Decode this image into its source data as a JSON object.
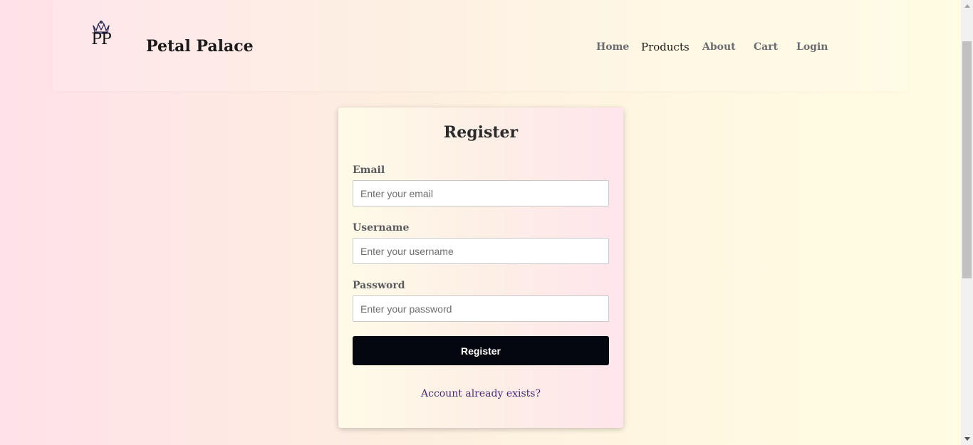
{
  "header": {
    "logo_monogram": "PP",
    "brand": "Petal Palace",
    "nav": [
      {
        "label": "Home"
      },
      {
        "label": "Products"
      },
      {
        "label": "About"
      },
      {
        "label": "Cart"
      },
      {
        "label": "Login"
      }
    ],
    "active_nav": "Products"
  },
  "form": {
    "title": "Register",
    "fields": [
      {
        "label": "Email",
        "placeholder": "Enter your email",
        "value": ""
      },
      {
        "label": "Username",
        "placeholder": "Enter your username",
        "value": ""
      },
      {
        "label": "Password",
        "placeholder": "Enter your password",
        "value": ""
      }
    ],
    "submit_label": "Register",
    "alt_link": "Account already exists?"
  },
  "colors": {
    "button_bg": "#05070f",
    "link": "#4a2a78",
    "crown": "#2a2a55"
  },
  "icons": {
    "logo": "crown-icon",
    "scroll_up": "caret-up-icon",
    "scroll_down": "caret-down-icon"
  }
}
